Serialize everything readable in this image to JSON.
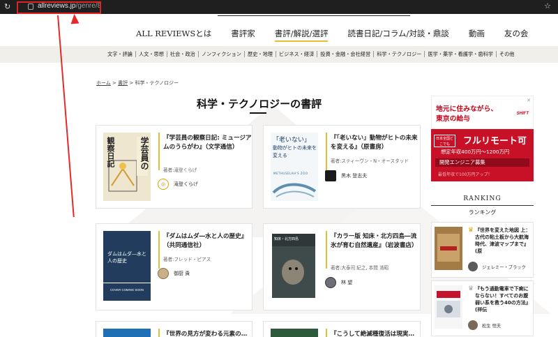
{
  "browser": {
    "url_host": "allreviews.jp",
    "url_path": "/genre/8"
  },
  "nav": {
    "items": [
      "ALL REVIEWSとは",
      "書評家",
      "書評/解説/選評",
      "読書日記/コラム/対談・鼎談",
      "動画",
      "友の会"
    ],
    "active_index": 2
  },
  "genres": [
    "文字・評論",
    "人文・思想",
    "社会・政治",
    "ノンフィクション",
    "歴史・地理",
    "ビジネス・経済",
    "投資・金融・会社経営",
    "科学・テクノロジー",
    "医学・薬学・看護学・歯科学",
    "その他"
  ],
  "breadcrumb": {
    "home": "ホーム",
    "reviews": "書評",
    "sep1": " > ",
    "sep2": " > ",
    "current": "科学・テクノロジー"
  },
  "page_title": "科学・テクノロジーの書評",
  "cards": [
    {
      "title": "『学芸員の観察日記: ミュージアムのうらがわ』（文学通信）",
      "author": "著者:滝登くらげ",
      "reviewer": "滝登くらげ",
      "cover_text_a": "学芸員の",
      "cover_text_b": "観察日記"
    },
    {
      "title": "『「老いない」動物がヒトの未来を変える』（原書房）",
      "author": "著者:スティーヴン・N・オースタッド",
      "reviewer": "黒木 登志夫",
      "cover_text_a": "「老いない」",
      "cover_text_b": "動物がヒトの未来を変える",
      "cover_text_c": "METHUSELAH'S ZOO"
    },
    {
      "title": "『ダムはムダ―水と人の歴史』（共同通信社）",
      "author": "著者:フレッド・ピアス",
      "reviewer": "御厨 貴",
      "cover_text_a": "ダムはムダ―水と人の歴史",
      "cover_text_b": "COVER COMING SOON"
    },
    {
      "title": "『カラー版 知床・北方四島―流氷が育む自然遺産』（岩波書店）",
      "author": "著者:大泰司 紀之, 本間 浩昭",
      "reviewer": "林 望",
      "cover_text_a": "知床・北方四島"
    },
    {
      "title": "『世界の見方が変わる元素の…",
      "author": "",
      "reviewer": ""
    },
    {
      "title": "『こうして絶滅種復活は現実…",
      "author": "",
      "reviewer": ""
    }
  ],
  "ad": {
    "line1": "地元に住みながら、",
    "line2": "東京の給与",
    "brand": "SHIFT",
    "badge": "日本全国どこでも",
    "headline": "フルリモート可",
    "salary": "想定年収400万円〜1200万円",
    "recruit": "開発エンジニア募集",
    "note": "最低年収で100万円アップ！"
  },
  "ranking": {
    "heading": "RANKING",
    "subheading": "ランキング",
    "items": [
      {
        "title": "『世界を変えた地図 上：古代の粘土板から大航海時代、津波マップまで』(原",
        "reviewer": "ジェレミー・ブラック"
      },
      {
        "title": "『もう通勤電車で下痢にならない！すべてのお腹弱い系を救う40の方法』(祥伝",
        "reviewer": "松生 恒夫"
      }
    ]
  },
  "colors": {
    "accent_gold": "#e0c038",
    "ad_red": "#c81126",
    "annotation_red": "#e42a2a"
  }
}
